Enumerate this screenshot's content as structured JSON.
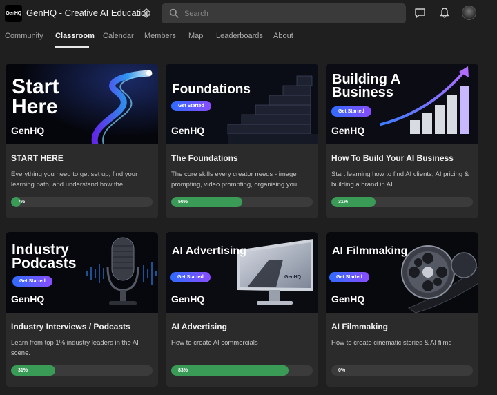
{
  "header": {
    "logo_text": "GenHQ",
    "group_name": "GenHQ - Creative AI Education",
    "search_placeholder": "Search",
    "icons": [
      "switch-community-icon",
      "search-icon",
      "chat-icon",
      "bell-icon",
      "avatar"
    ]
  },
  "tabs": [
    {
      "label": "Community",
      "active": false
    },
    {
      "label": "Classroom",
      "active": true
    },
    {
      "label": "Calendar",
      "active": false
    },
    {
      "label": "Members",
      "active": false
    },
    {
      "label": "Map",
      "active": false
    },
    {
      "label": "Leaderboards",
      "active": false
    },
    {
      "label": "About",
      "active": false
    }
  ],
  "colors": {
    "background": "#1f1f1f",
    "card": "#2b2b2b",
    "progress_fill": "#3a9b57",
    "progress_track": "#3b3b3b",
    "cta_gradient": [
      "#2f6bff",
      "#8a4dff"
    ]
  },
  "courses": [
    {
      "thumb_title": "Start Here",
      "thumb_brand": "GenHQ",
      "title": "START HERE",
      "description": "Everything you need to get set up, find your learning path, and understand how the…",
      "progress": 7,
      "progress_label": "7%"
    },
    {
      "thumb_title": "Foundations",
      "thumb_cta": "Get Started",
      "thumb_brand": "GenHQ",
      "title": "The Foundations",
      "description": "The core skills every creator needs - image prompting, video prompting, organising you…",
      "progress": 50,
      "progress_label": "50%"
    },
    {
      "thumb_title": "Building A Business",
      "thumb_cta": "Get Started",
      "thumb_brand": "GenHQ",
      "title": "How To Build Your AI Business",
      "description": "Start learning how to find AI clients, AI pricing & building a brand in AI",
      "progress": 31,
      "progress_label": "31%"
    },
    {
      "thumb_title": "Industry Podcasts",
      "thumb_cta": "Get Started",
      "thumb_brand": "GenHQ",
      "title": "Industry Interviews / Podcasts",
      "description": "Learn from top 1% industry leaders in the AI scene.",
      "progress": 31,
      "progress_label": "31%"
    },
    {
      "thumb_title": "AI Advertising",
      "thumb_cta": "Get Started",
      "thumb_brand": "GenHQ",
      "thumb_screen_text": "GenHQ",
      "title": "AI Advertising",
      "description": "How to create AI commercials",
      "progress": 83,
      "progress_label": "83%"
    },
    {
      "thumb_title": "AI Filmmaking",
      "thumb_cta": "Get Started",
      "thumb_brand": "GenHQ",
      "title": "AI Filmmaking",
      "description": "How to create cinematic stories & AI films",
      "progress": 0,
      "progress_label": "0%"
    }
  ]
}
